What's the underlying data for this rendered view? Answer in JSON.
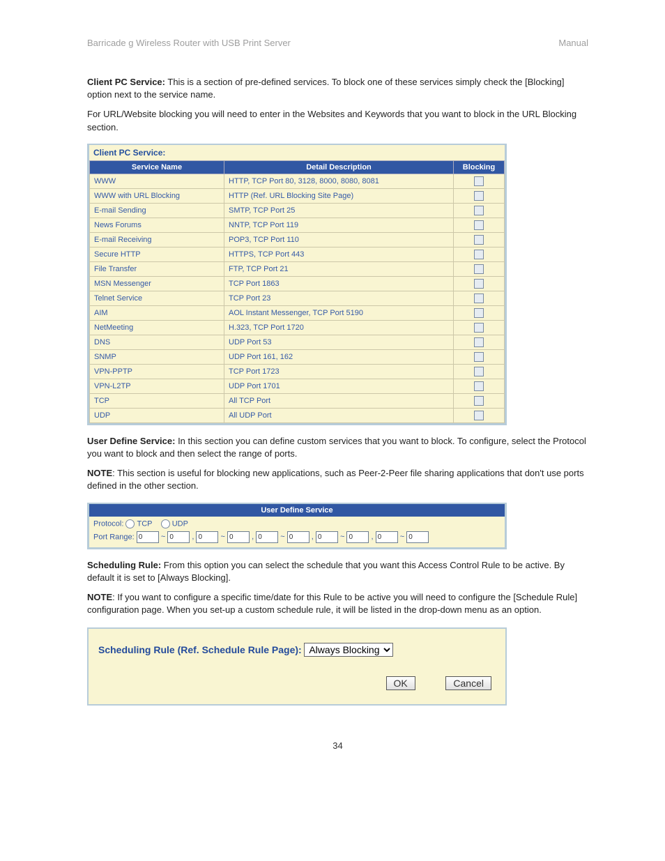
{
  "header": {
    "left": "Barricade g Wireless Router with USB Print Server",
    "right": "Manual"
  },
  "intro": {
    "client_label": "Client PC Service:",
    "client_text": " This is a section of pre-defined services. To block one of these services simply check the [Blocking] option next to the service name.",
    "url_text": "For URL/Website blocking you will need to enter in the Websites and Keywords that you want to block in the URL Blocking section."
  },
  "svc_table": {
    "title": "Client PC Service:",
    "headers": {
      "name": "Service Name",
      "desc": "Detail Description",
      "block": "Blocking"
    },
    "rows": [
      {
        "name": "WWW",
        "desc": "HTTP, TCP Port 80, 3128, 8000, 8080, 8081"
      },
      {
        "name": "WWW with URL Blocking",
        "desc": "HTTP (Ref. URL Blocking Site Page)"
      },
      {
        "name": "E-mail Sending",
        "desc": "SMTP, TCP Port 25"
      },
      {
        "name": "News Forums",
        "desc": "NNTP, TCP Port 119"
      },
      {
        "name": "E-mail Receiving",
        "desc": "POP3, TCP Port 110"
      },
      {
        "name": "Secure HTTP",
        "desc": "HTTPS, TCP Port 443"
      },
      {
        "name": "File Transfer",
        "desc": "FTP, TCP Port 21"
      },
      {
        "name": "MSN Messenger",
        "desc": "TCP Port 1863"
      },
      {
        "name": "Telnet Service",
        "desc": "TCP Port 23"
      },
      {
        "name": "AIM",
        "desc": "AOL Instant Messenger, TCP Port 5190"
      },
      {
        "name": "NetMeeting",
        "desc": "H.323, TCP Port 1720"
      },
      {
        "name": "DNS",
        "desc": "UDP Port 53"
      },
      {
        "name": "SNMP",
        "desc": "UDP Port 161, 162"
      },
      {
        "name": "VPN-PPTP",
        "desc": "TCP Port 1723"
      },
      {
        "name": "VPN-L2TP",
        "desc": "UDP Port 1701"
      },
      {
        "name": "TCP",
        "desc": "All TCP Port"
      },
      {
        "name": "UDP",
        "desc": "All UDP Port"
      }
    ]
  },
  "uds": {
    "label": "User Define Service:",
    "label_text": " In this section you can define custom services that you want to block. To configure, select the Protocol you want to block and then select the range of ports.",
    "note_label": "NOTE",
    "note_text": ": This section is useful for blocking new applications, such as Peer-2-Peer file sharing applications that don't use ports defined in the other section.",
    "panel_title": "User Define Service",
    "protocol_label": "Protocol:",
    "tcp": "TCP",
    "udp": "UDP",
    "portrange_label": "Port Range:",
    "zero": "0",
    "tilde": "~",
    "comma": ","
  },
  "sched": {
    "label": "Scheduling Rule:",
    "label_text": " From this option you can select the schedule that you want this Access Control Rule to be active. By default it is set to [Always Blocking].",
    "note_label": "NOTE",
    "note_text": ": If you want to configure a specific time/date for this Rule to be active you will need to configure the [Schedule Rule] configuration page. When you set-up a custom schedule rule, it will be listed in the drop-down menu as an option.",
    "panel_label": "Scheduling Rule (Ref. Schedule Rule Page):",
    "selected": "Always Blocking",
    "ok": "OK",
    "cancel": "Cancel"
  },
  "page_number": "34"
}
